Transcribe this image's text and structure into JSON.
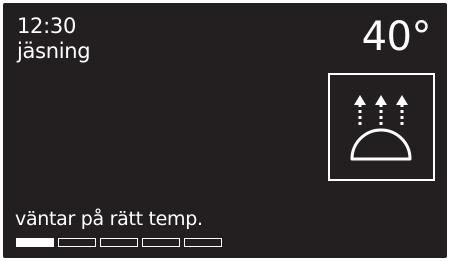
{
  "header": {
    "time": "12:30",
    "program": "jäsning",
    "temperature": "40°"
  },
  "mode": {
    "icon": "proofing-dome-heat-icon"
  },
  "status": {
    "text": "väntar på rätt temp."
  },
  "progress": {
    "segments_total": 5,
    "segments_filled": 1
  },
  "colors": {
    "screen_background": "#231f20",
    "foreground": "#ffffff"
  }
}
